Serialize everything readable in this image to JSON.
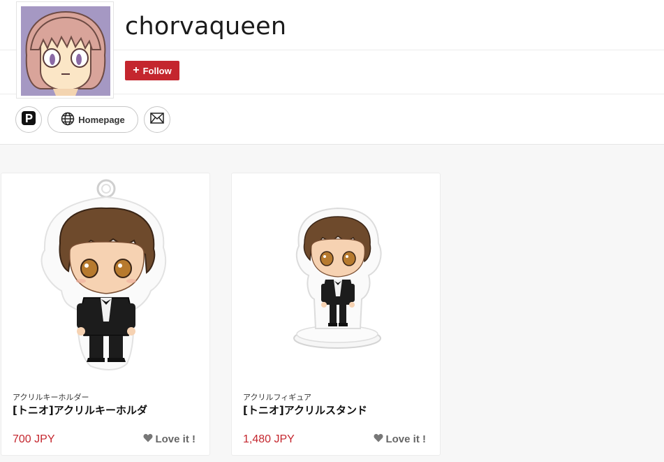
{
  "profile": {
    "username": "chorvaqueen",
    "follow_label": "Follow"
  },
  "links": {
    "homepage_label": "Homepage"
  },
  "products": [
    {
      "category": "アクリルキーホルダー",
      "title": "[トニオ]アクリルキーホルダ",
      "price": "700 JPY",
      "love_label": "Love it !"
    },
    {
      "category": "アクリルフィギュア",
      "title": "[トニオ]アクリルスタンド",
      "price": "1,480 JPY",
      "love_label": "Love it !"
    }
  ],
  "icons": {
    "follow": "plus-icon",
    "pixiv": "pixiv-icon",
    "homepage": "globe-icon",
    "mail": "envelope-icon",
    "love": "heart-icon"
  },
  "colors": {
    "accent": "#c4262e",
    "page_bg": "#f7f7f7"
  }
}
